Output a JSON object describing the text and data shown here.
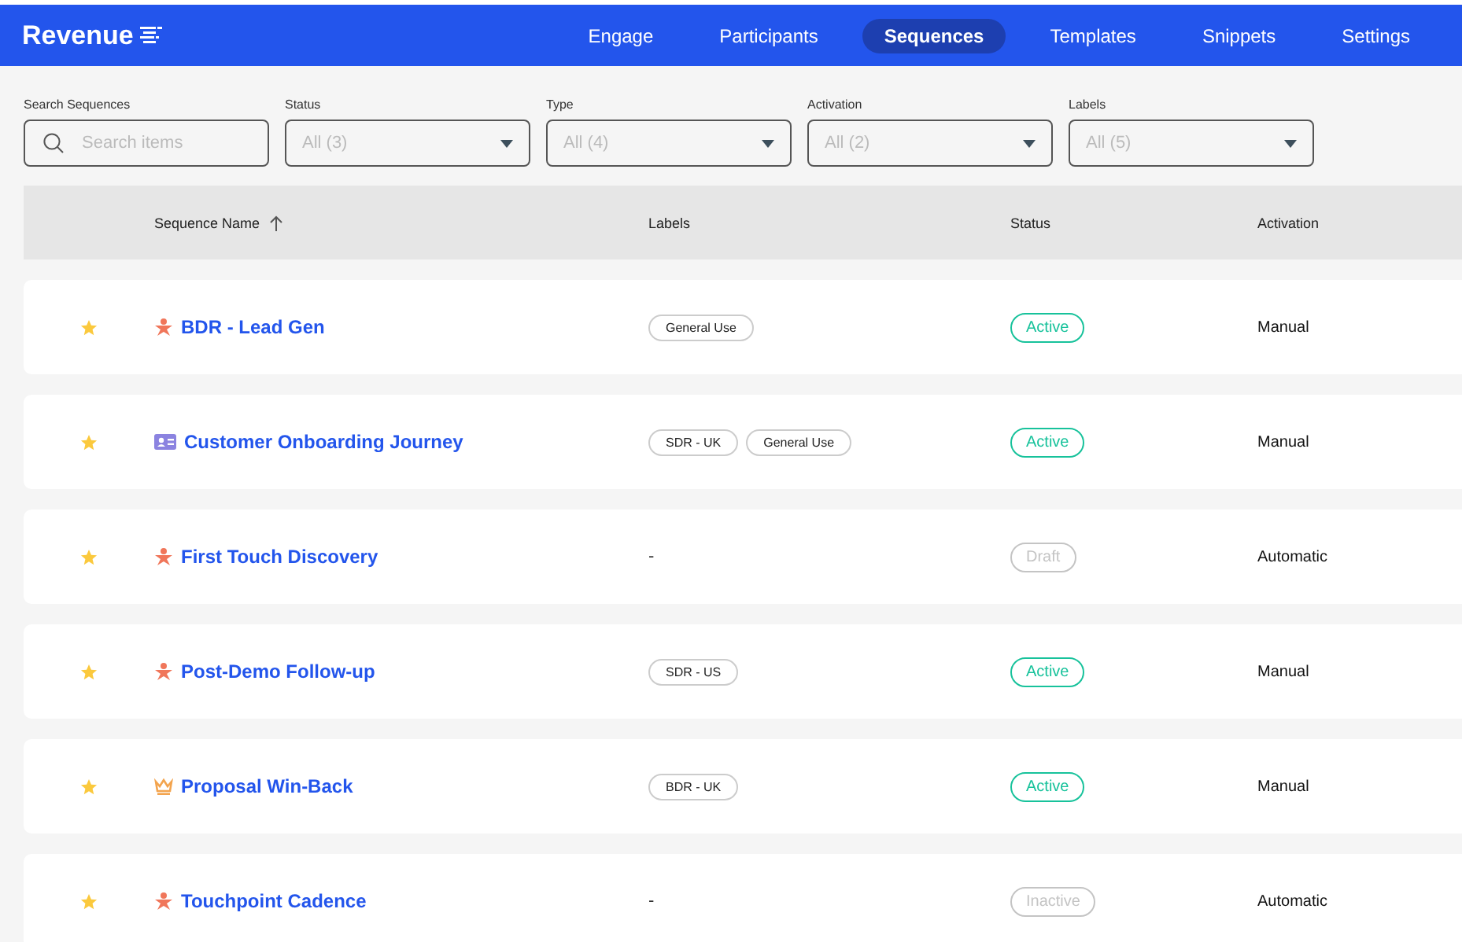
{
  "app": {
    "logo": "Revenue"
  },
  "nav": [
    {
      "label": "Engage",
      "selected": false
    },
    {
      "label": "Participants",
      "selected": false
    },
    {
      "label": "Sequences",
      "selected": true
    },
    {
      "label": "Templates",
      "selected": false
    },
    {
      "label": "Snippets",
      "selected": false
    },
    {
      "label": "Settings",
      "selected": false
    }
  ],
  "filters": {
    "search": {
      "label": "Search Sequences",
      "placeholder": "Search items"
    },
    "dropdowns": [
      {
        "label": "Status",
        "value": "All (3)"
      },
      {
        "label": "Type",
        "value": "All (4)"
      },
      {
        "label": "Activation",
        "value": "All (2)"
      },
      {
        "label": "Labels",
        "value": "All (5)"
      }
    ]
  },
  "table": {
    "columns": [
      {
        "label": "Sequence Name",
        "sorted_ascending": true
      },
      {
        "label": "Labels"
      },
      {
        "label": "Status"
      },
      {
        "label": "Activation"
      }
    ],
    "rows": [
      {
        "starred": true,
        "kind": "person",
        "name": "BDR - Lead Gen",
        "labels": [
          "General Use"
        ],
        "status": {
          "kind": "active",
          "text": "Active"
        },
        "activation": "Manual"
      },
      {
        "starred": true,
        "kind": "card",
        "name": "Customer Onboarding Journey",
        "labels": [
          "SDR - UK",
          "General Use"
        ],
        "status": {
          "kind": "active",
          "text": "Active"
        },
        "activation": "Manual"
      },
      {
        "starred": true,
        "kind": "person",
        "name": "First Touch Discovery",
        "empty_labels": "-",
        "status": {
          "kind": "draft",
          "text": "Draft"
        },
        "activation": "Automatic"
      },
      {
        "starred": true,
        "kind": "person",
        "name": "Post-Demo Follow-up",
        "labels": [
          "SDR - US"
        ],
        "status": {
          "kind": "active",
          "text": "Active"
        },
        "activation": "Manual"
      },
      {
        "starred": true,
        "kind": "crown",
        "name": "Proposal Win-Back",
        "labels": [
          "BDR - UK"
        ],
        "status": {
          "kind": "active",
          "text": "Active"
        },
        "activation": "Manual"
      },
      {
        "starred": true,
        "kind": "person",
        "name": "Touchpoint Cadence",
        "empty_labels": "-",
        "status": {
          "kind": "inactive",
          "text": "Inactive"
        },
        "activation": "Automatic"
      }
    ]
  }
}
